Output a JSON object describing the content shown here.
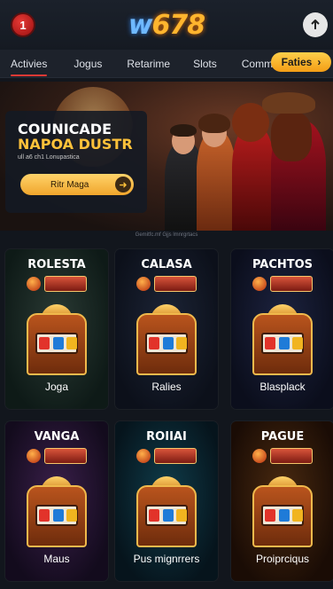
{
  "header": {
    "badge": "1",
    "logo_w": "w",
    "logo_num": "678",
    "up_icon": "up-arrow-icon"
  },
  "tabs": [
    {
      "label": "Activies",
      "active": true
    },
    {
      "label": "Jogus"
    },
    {
      "label": "Retarime"
    },
    {
      "label": "Slots"
    },
    {
      "label": "Commenet"
    }
  ],
  "tab_pill": {
    "label": "Faties",
    "icon": "chevron-right-icon"
  },
  "hero": {
    "title_line1": "COUNICADE",
    "title_line2": "NAPOA DUSTR",
    "subtitle": "ull a6 ch1 Lonupastica",
    "button_label": "Ritr Maga",
    "caption": "Gemitfc.mf Gjjs lmnrgrtacs"
  },
  "games": [
    {
      "title": "ROLESTA",
      "label": "Joga",
      "bg_top": "#2a3a34",
      "bg_bottom": "#0e1a17"
    },
    {
      "title": "CALASA",
      "label": "Ralies",
      "bg_top": "#1c2436",
      "bg_bottom": "#0c101a"
    },
    {
      "title": "PACHTOS",
      "label": "Blasplack",
      "bg_top": "#1d2340",
      "bg_bottom": "#0b0e1c"
    },
    {
      "title": "VANGA",
      "label": "Maus",
      "bg_top": "#3a1f4a",
      "bg_bottom": "#130b1d"
    },
    {
      "title": "ROIIAI",
      "label": "Pus mignrrers",
      "bg_top": "#0f3c4a",
      "bg_bottom": "#06141c"
    },
    {
      "title": "PAGUE",
      "label": "Proiprciqus",
      "bg_top": "#4a2a10",
      "bg_bottom": "#1a0c05"
    }
  ]
}
